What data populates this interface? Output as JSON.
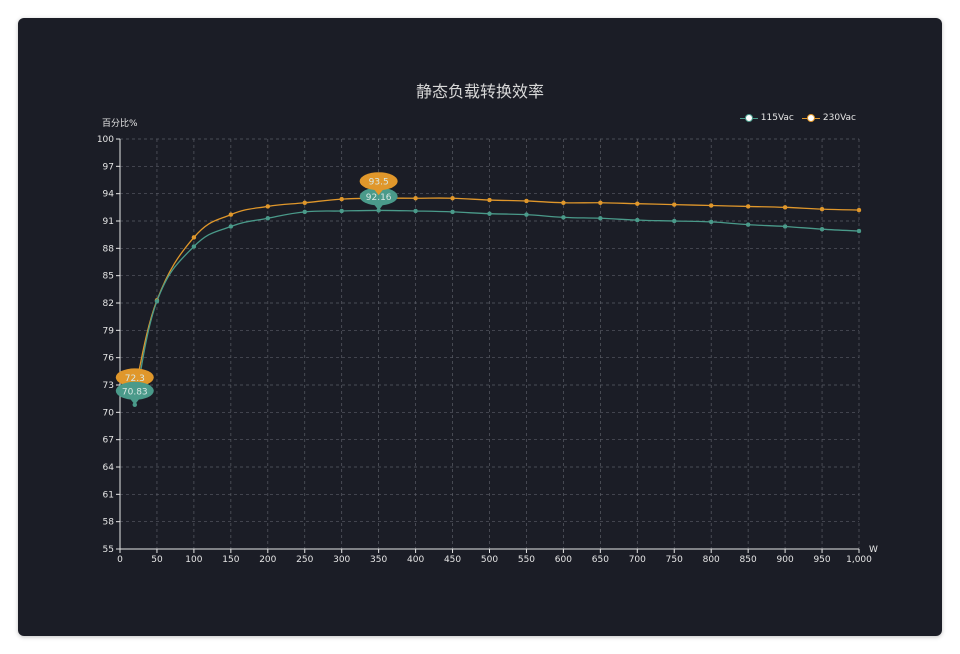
{
  "chart_data": {
    "type": "line",
    "title": "静态负载转换效率",
    "ylabel": "百分比%",
    "xlabel": "W",
    "xlim": [
      0,
      1000
    ],
    "ylim": [
      55,
      100
    ],
    "x_ticks": [
      "0",
      "50",
      "100",
      "150",
      "200",
      "250",
      "300",
      "350",
      "400",
      "450",
      "500",
      "550",
      "600",
      "650",
      "700",
      "750",
      "800",
      "850",
      "900",
      "950",
      "1,000"
    ],
    "y_ticks": [
      "55",
      "58",
      "61",
      "64",
      "67",
      "70",
      "73",
      "76",
      "79",
      "82",
      "85",
      "88",
      "91",
      "94",
      "97",
      "100"
    ],
    "grid": true,
    "legend_position": "top-right",
    "series": [
      {
        "name": "115Vac",
        "color": "#4a9a8a",
        "points": [
          [
            20,
            70.83
          ],
          [
            50,
            82.2
          ],
          [
            100,
            88.2
          ],
          [
            150,
            90.4
          ],
          [
            200,
            91.3
          ],
          [
            250,
            92.0
          ],
          [
            300,
            92.1
          ],
          [
            350,
            92.16
          ],
          [
            400,
            92.1
          ],
          [
            450,
            92.0
          ],
          [
            500,
            91.8
          ],
          [
            550,
            91.7
          ],
          [
            600,
            91.4
          ],
          [
            650,
            91.3
          ],
          [
            700,
            91.1
          ],
          [
            750,
            91.0
          ],
          [
            800,
            90.9
          ],
          [
            850,
            90.6
          ],
          [
            900,
            90.4
          ],
          [
            950,
            90.1
          ],
          [
            1000,
            89.9
          ]
        ],
        "markers": [
          {
            "x": 20,
            "y": 70.83,
            "label": "70.83",
            "kind": "min"
          },
          {
            "x": 350,
            "y": 92.16,
            "label": "92.16",
            "kind": "max"
          }
        ]
      },
      {
        "name": "230Vac",
        "color": "#e0972b",
        "points": [
          [
            20,
            72.3
          ],
          [
            50,
            82.3
          ],
          [
            100,
            89.2
          ],
          [
            150,
            91.7
          ],
          [
            200,
            92.6
          ],
          [
            250,
            93.0
          ],
          [
            300,
            93.4
          ],
          [
            350,
            93.5
          ],
          [
            400,
            93.5
          ],
          [
            450,
            93.5
          ],
          [
            500,
            93.3
          ],
          [
            550,
            93.2
          ],
          [
            600,
            93.0
          ],
          [
            650,
            93.0
          ],
          [
            700,
            92.9
          ],
          [
            750,
            92.8
          ],
          [
            800,
            92.7
          ],
          [
            850,
            92.6
          ],
          [
            900,
            92.5
          ],
          [
            950,
            92.3
          ],
          [
            1000,
            92.2
          ]
        ],
        "markers": [
          {
            "x": 20,
            "y": 72.3,
            "label": "72.3",
            "kind": "min"
          },
          {
            "x": 350,
            "y": 93.5,
            "label": "93.5",
            "kind": "max"
          }
        ]
      }
    ]
  }
}
